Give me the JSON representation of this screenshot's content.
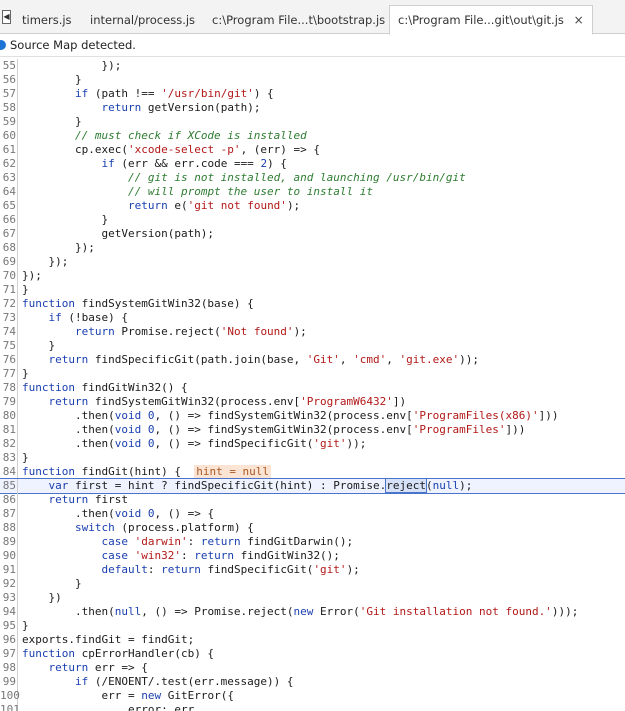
{
  "tabs": [
    {
      "label": "timers.js",
      "active": false
    },
    {
      "label": "internal/process.js",
      "active": false
    },
    {
      "label": "c:\\Program File...t\\bootstrap.js",
      "active": false
    },
    {
      "label": "c:\\Program File...git\\out\\git.js",
      "active": true
    }
  ],
  "tab_close_glyph": "×",
  "infobar": {
    "text": "Source Map detected."
  },
  "editor": {
    "current_line": 85,
    "lines": [
      {
        "n": "55",
        "t": [
          [
            "p",
            "            });"
          ]
        ]
      },
      {
        "n": "56",
        "t": [
          [
            "p",
            "        }"
          ]
        ]
      },
      {
        "n": "57",
        "t": [
          [
            "p",
            "        "
          ],
          [
            "k",
            "if"
          ],
          [
            "p",
            " (path !== "
          ],
          [
            "s",
            "'/usr/bin/git'"
          ],
          [
            "p",
            ") {"
          ]
        ]
      },
      {
        "n": "58",
        "t": [
          [
            "p",
            "            "
          ],
          [
            "k",
            "return"
          ],
          [
            "p",
            " getVersion(path);"
          ]
        ]
      },
      {
        "n": "59",
        "t": [
          [
            "p",
            "        }"
          ]
        ]
      },
      {
        "n": "60",
        "t": [
          [
            "p",
            "        "
          ],
          [
            "c",
            "// must check if XCode is installed"
          ]
        ]
      },
      {
        "n": "61",
        "t": [
          [
            "p",
            "        cp.exec("
          ],
          [
            "s",
            "'xcode-select -p'"
          ],
          [
            "p",
            ", (err) => {"
          ]
        ]
      },
      {
        "n": "62",
        "t": [
          [
            "p",
            "            "
          ],
          [
            "k",
            "if"
          ],
          [
            "p",
            " (err && err.code === "
          ],
          [
            "n",
            "2"
          ],
          [
            "p",
            ") {"
          ]
        ]
      },
      {
        "n": "63",
        "t": [
          [
            "p",
            "                "
          ],
          [
            "c",
            "// git is not installed, and launching /usr/bin/git"
          ]
        ]
      },
      {
        "n": "64",
        "t": [
          [
            "p",
            "                "
          ],
          [
            "c",
            "// will prompt the user to install it"
          ]
        ]
      },
      {
        "n": "65",
        "t": [
          [
            "p",
            "                "
          ],
          [
            "k",
            "return"
          ],
          [
            "p",
            " e("
          ],
          [
            "s",
            "'git not found'"
          ],
          [
            "p",
            ");"
          ]
        ]
      },
      {
        "n": "66",
        "t": [
          [
            "p",
            "            }"
          ]
        ]
      },
      {
        "n": "67",
        "t": [
          [
            "p",
            "            getVersion(path);"
          ]
        ]
      },
      {
        "n": "68",
        "t": [
          [
            "p",
            "        });"
          ]
        ]
      },
      {
        "n": "69",
        "t": [
          [
            "p",
            "    });"
          ]
        ]
      },
      {
        "n": "70",
        "t": [
          [
            "p",
            "});"
          ]
        ]
      },
      {
        "n": "71",
        "t": [
          [
            "p",
            "}"
          ]
        ]
      },
      {
        "n": "72",
        "t": [
          [
            "k",
            "function"
          ],
          [
            "p",
            " findSystemGitWin32(base) {"
          ]
        ]
      },
      {
        "n": "73",
        "t": [
          [
            "p",
            "    "
          ],
          [
            "k",
            "if"
          ],
          [
            "p",
            " (!base) {"
          ]
        ]
      },
      {
        "n": "74",
        "t": [
          [
            "p",
            "        "
          ],
          [
            "k",
            "return"
          ],
          [
            "p",
            " Promise.reject("
          ],
          [
            "s",
            "'Not found'"
          ],
          [
            "p",
            ");"
          ]
        ]
      },
      {
        "n": "75",
        "t": [
          [
            "p",
            "    }"
          ]
        ]
      },
      {
        "n": "76",
        "t": [
          [
            "p",
            "    "
          ],
          [
            "k",
            "return"
          ],
          [
            "p",
            " findSpecificGit(path.join(base, "
          ],
          [
            "s",
            "'Git'"
          ],
          [
            "p",
            ", "
          ],
          [
            "s",
            "'cmd'"
          ],
          [
            "p",
            ", "
          ],
          [
            "s",
            "'git.exe'"
          ],
          [
            "p",
            "));"
          ]
        ]
      },
      {
        "n": "77",
        "t": [
          [
            "p",
            "}"
          ]
        ]
      },
      {
        "n": "78",
        "t": [
          [
            "k",
            "function"
          ],
          [
            "p",
            " findGitWin32() {"
          ]
        ]
      },
      {
        "n": "79",
        "t": [
          [
            "p",
            "    "
          ],
          [
            "k",
            "return"
          ],
          [
            "p",
            " findSystemGitWin32(process.env["
          ],
          [
            "s",
            "'ProgramW6432'"
          ],
          [
            "p",
            "])"
          ]
        ]
      },
      {
        "n": "80",
        "t": [
          [
            "p",
            "        .then("
          ],
          [
            "k",
            "void"
          ],
          [
            "p",
            " "
          ],
          [
            "n",
            "0"
          ],
          [
            "p",
            ", () => findSystemGitWin32(process.env["
          ],
          [
            "s",
            "'ProgramFiles(x86)'"
          ],
          [
            "p",
            "]))"
          ]
        ]
      },
      {
        "n": "81",
        "t": [
          [
            "p",
            "        .then("
          ],
          [
            "k",
            "void"
          ],
          [
            "p",
            " "
          ],
          [
            "n",
            "0"
          ],
          [
            "p",
            ", () => findSystemGitWin32(process.env["
          ],
          [
            "s",
            "'ProgramFiles'"
          ],
          [
            "p",
            "]))"
          ]
        ]
      },
      {
        "n": "82",
        "t": [
          [
            "p",
            "        .then("
          ],
          [
            "k",
            "void"
          ],
          [
            "p",
            " "
          ],
          [
            "n",
            "0"
          ],
          [
            "p",
            ", () => findSpecificGit("
          ],
          [
            "s",
            "'git'"
          ],
          [
            "p",
            "));"
          ]
        ]
      },
      {
        "n": "83",
        "t": [
          [
            "p",
            "}"
          ]
        ]
      },
      {
        "n": "84",
        "t": [
          [
            "k",
            "function"
          ],
          [
            "p",
            " findGit(hint) {  "
          ],
          [
            "h",
            "hint = null"
          ]
        ]
      },
      {
        "n": "85",
        "t": [
          [
            "p",
            "    "
          ],
          [
            "k",
            "var"
          ],
          [
            "p",
            " first = hint ? findSpecificGit(hint) : Promise."
          ],
          [
            "x",
            "reject"
          ],
          [
            "p",
            "("
          ],
          [
            "k",
            "null"
          ],
          [
            "p",
            ");"
          ]
        ]
      },
      {
        "n": "86",
        "t": [
          [
            "p",
            "    "
          ],
          [
            "k",
            "return"
          ],
          [
            "p",
            " first"
          ]
        ]
      },
      {
        "n": "87",
        "t": [
          [
            "p",
            "        .then("
          ],
          [
            "k",
            "void"
          ],
          [
            "p",
            " "
          ],
          [
            "n",
            "0"
          ],
          [
            "p",
            ", () => {"
          ]
        ]
      },
      {
        "n": "88",
        "t": [
          [
            "p",
            "        "
          ],
          [
            "k",
            "switch"
          ],
          [
            "p",
            " (process.platform) {"
          ]
        ]
      },
      {
        "n": "89",
        "t": [
          [
            "p",
            "            "
          ],
          [
            "k",
            "case"
          ],
          [
            "p",
            " "
          ],
          [
            "s",
            "'darwin'"
          ],
          [
            "p",
            ": "
          ],
          [
            "k",
            "return"
          ],
          [
            "p",
            " findGitDarwin();"
          ]
        ]
      },
      {
        "n": "90",
        "t": [
          [
            "p",
            "            "
          ],
          [
            "k",
            "case"
          ],
          [
            "p",
            " "
          ],
          [
            "s",
            "'win32'"
          ],
          [
            "p",
            ": "
          ],
          [
            "k",
            "return"
          ],
          [
            "p",
            " findGitWin32();"
          ]
        ]
      },
      {
        "n": "91",
        "t": [
          [
            "p",
            "            "
          ],
          [
            "k",
            "default"
          ],
          [
            "p",
            ": "
          ],
          [
            "k",
            "return"
          ],
          [
            "p",
            " findSpecificGit("
          ],
          [
            "s",
            "'git'"
          ],
          [
            "p",
            ");"
          ]
        ]
      },
      {
        "n": "92",
        "t": [
          [
            "p",
            "        }"
          ]
        ]
      },
      {
        "n": "93",
        "t": [
          [
            "p",
            "    })"
          ]
        ]
      },
      {
        "n": "94",
        "t": [
          [
            "p",
            "        .then("
          ],
          [
            "k",
            "null"
          ],
          [
            "p",
            ", () => Promise.reject("
          ],
          [
            "k",
            "new"
          ],
          [
            "p",
            " Error("
          ],
          [
            "s",
            "'Git installation not found.'"
          ],
          [
            "p",
            ")));"
          ]
        ]
      },
      {
        "n": "95",
        "t": [
          [
            "p",
            "}"
          ]
        ]
      },
      {
        "n": "96",
        "t": [
          [
            "p",
            "exports.findGit = findGit;"
          ]
        ]
      },
      {
        "n": "97",
        "t": [
          [
            "k",
            "function"
          ],
          [
            "p",
            " cpErrorHandler(cb) {"
          ]
        ]
      },
      {
        "n": "98",
        "t": [
          [
            "p",
            "    "
          ],
          [
            "k",
            "return"
          ],
          [
            "p",
            " err => {"
          ]
        ]
      },
      {
        "n": "99",
        "t": [
          [
            "p",
            "        "
          ],
          [
            "k",
            "if"
          ],
          [
            "p",
            " (/ENOENT/.test(err.message)) {"
          ]
        ]
      },
      {
        "n": "100",
        "t": [
          [
            "p",
            "            err = "
          ],
          [
            "k",
            "new"
          ],
          [
            "p",
            " GitError({"
          ]
        ]
      },
      {
        "n": "101",
        "t": [
          [
            "p",
            "                error: err,"
          ]
        ]
      }
    ]
  }
}
